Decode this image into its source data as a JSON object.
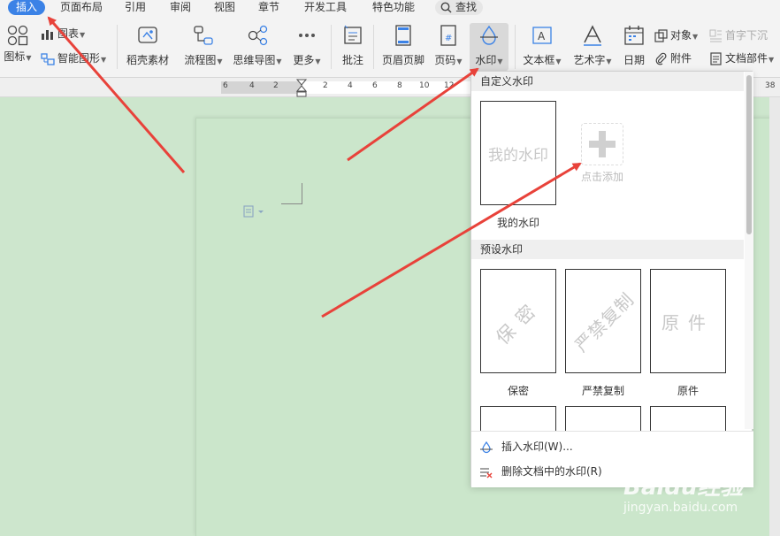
{
  "menu": {
    "tabs": [
      {
        "label": "插入",
        "active": true
      },
      {
        "label": "页面布局"
      },
      {
        "label": "引用"
      },
      {
        "label": "审阅"
      },
      {
        "label": "视图"
      },
      {
        "label": "章节"
      },
      {
        "label": "开发工具"
      },
      {
        "label": "特色功能"
      }
    ],
    "search_label": "查找"
  },
  "ribbon": {
    "icon_label": "图标",
    "chart_label": "图表",
    "smart_graphic_label": "智能图形",
    "docer_label": "稻壳素材",
    "flowchart_label": "流程图",
    "mindmap_label": "思维导图",
    "more_label": "更多",
    "comment_label": "批注",
    "header_footer_label": "页眉页脚",
    "page_number_label": "页码",
    "watermark_label": "水印",
    "textbox_label": "文本框",
    "wordart_label": "艺术字",
    "date_label": "日期",
    "object_label": "对象",
    "attachment_label": "附件",
    "drop_cap_label": "首字下沉",
    "doc_parts_label": "文档部件"
  },
  "ruler": {
    "ticks_left": [
      "6",
      "4",
      "2"
    ],
    "ticks_right": [
      "2",
      "4",
      "6",
      "8",
      "10",
      "12"
    ],
    "tick_end": "38"
  },
  "watermark_panel": {
    "custom_section": "自定义水印",
    "my_watermark_text": "我的水印",
    "my_watermark_caption": "我的水印",
    "add_label": "点击添加",
    "preset_section": "预设水印",
    "presets": [
      {
        "text": "保密",
        "caption": "保密"
      },
      {
        "text": "严禁复制",
        "caption": "严禁复制"
      },
      {
        "text": "原件",
        "caption": "原件"
      }
    ],
    "insert_action": "插入水印(W)...",
    "delete_action": "删除文档中的水印(R)"
  },
  "brand": {
    "logo_text": "Baidu经验",
    "url": "jingyan.baidu.com"
  },
  "colors": {
    "accent": "#3b82e6",
    "doc_background": "#cde6cd",
    "arrow": "#e8423a"
  }
}
